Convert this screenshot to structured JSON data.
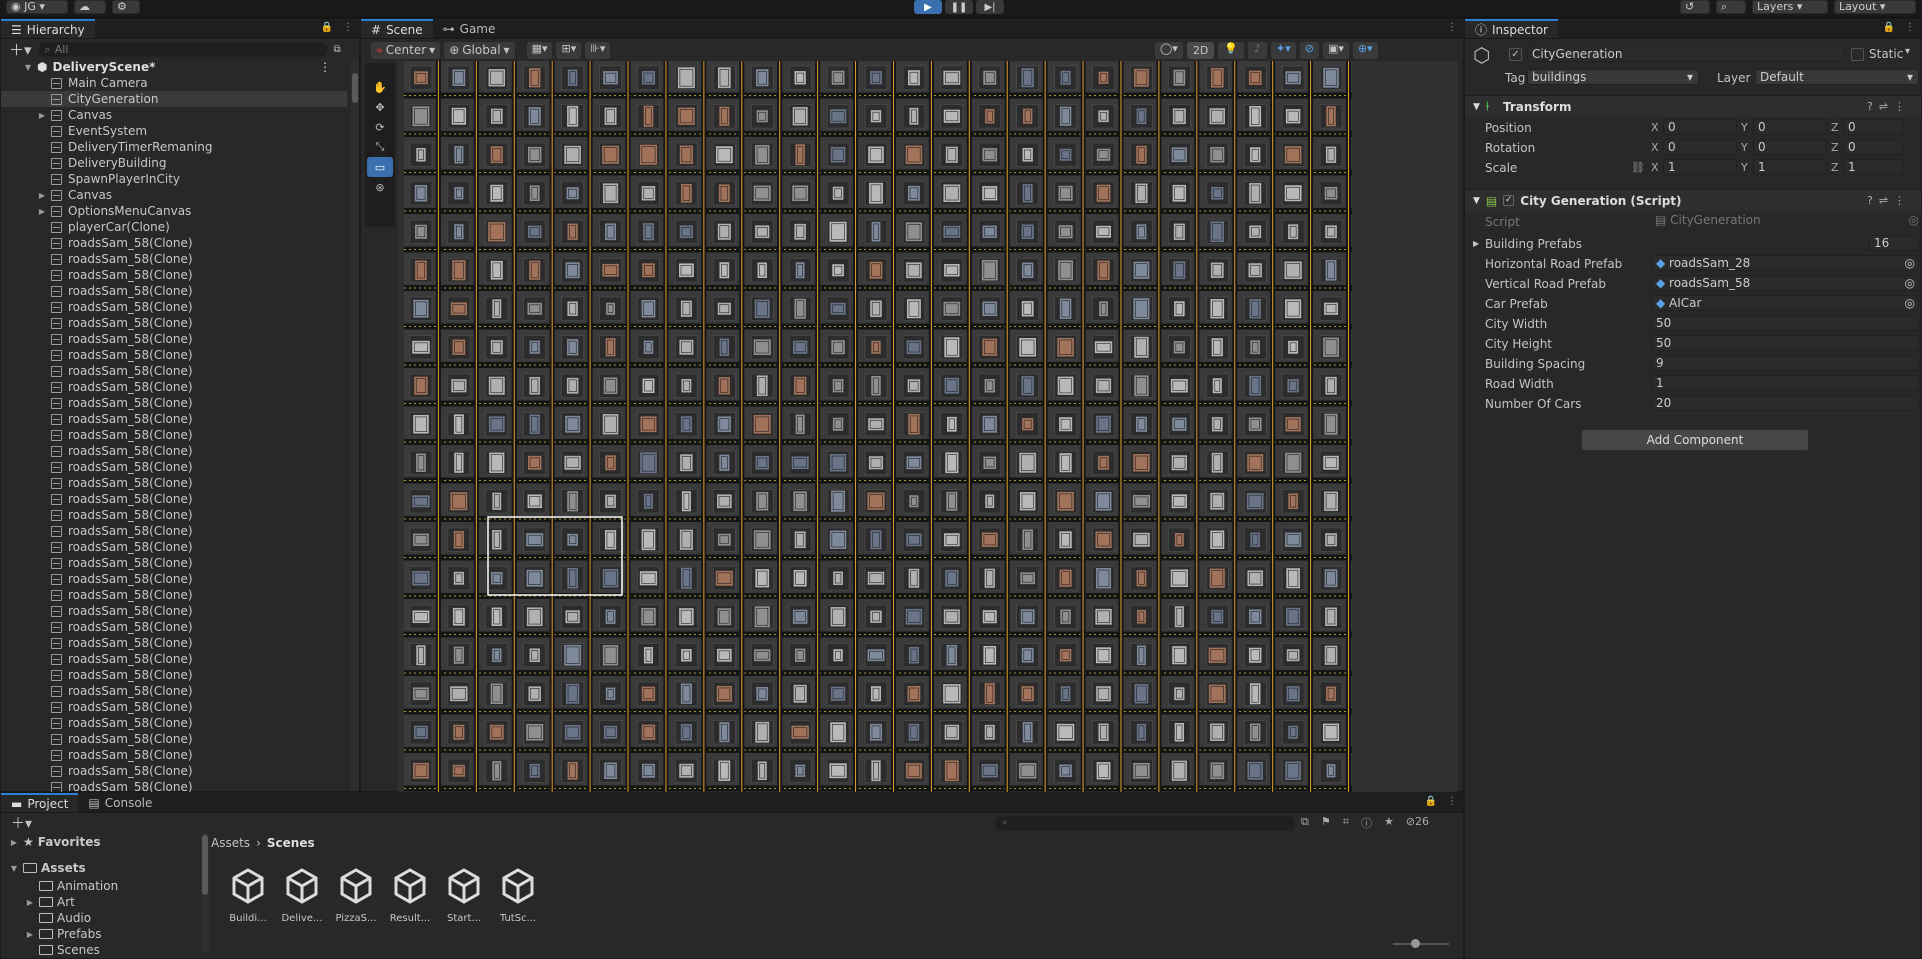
{
  "topbar": {
    "account": "JG",
    "layers": "Layers",
    "layout": "Layout"
  },
  "hierarchy": {
    "tab": "Hierarchy",
    "search_placeholder": "All",
    "scene": "DeliveryScene*",
    "items": [
      {
        "label": "Main Camera",
        "expand": false
      },
      {
        "label": "CityGeneration",
        "expand": false,
        "selected": true
      },
      {
        "label": "Canvas",
        "expand": true
      },
      {
        "label": "EventSystem",
        "expand": false
      },
      {
        "label": "DeliveryTimerRemaning",
        "expand": false
      },
      {
        "label": "DeliveryBuilding",
        "expand": false
      },
      {
        "label": "SpawnPlayerInCity",
        "expand": false
      },
      {
        "label": "Canvas",
        "expand": true
      },
      {
        "label": "OptionsMenuCanvas",
        "expand": true
      },
      {
        "label": "playerCar(Clone)",
        "expand": false
      },
      {
        "label": "roadsSam_58(Clone)",
        "expand": false
      },
      {
        "label": "roadsSam_58(Clone)",
        "expand": false
      },
      {
        "label": "roadsSam_58(Clone)",
        "expand": false
      },
      {
        "label": "roadsSam_58(Clone)",
        "expand": false
      },
      {
        "label": "roadsSam_58(Clone)",
        "expand": false
      },
      {
        "label": "roadsSam_58(Clone)",
        "expand": false
      },
      {
        "label": "roadsSam_58(Clone)",
        "expand": false
      },
      {
        "label": "roadsSam_58(Clone)",
        "expand": false
      },
      {
        "label": "roadsSam_58(Clone)",
        "expand": false
      },
      {
        "label": "roadsSam_58(Clone)",
        "expand": false
      },
      {
        "label": "roadsSam_58(Clone)",
        "expand": false
      },
      {
        "label": "roadsSam_58(Clone)",
        "expand": false
      },
      {
        "label": "roadsSam_58(Clone)",
        "expand": false
      },
      {
        "label": "roadsSam_58(Clone)",
        "expand": false
      },
      {
        "label": "roadsSam_58(Clone)",
        "expand": false
      },
      {
        "label": "roadsSam_58(Clone)",
        "expand": false
      },
      {
        "label": "roadsSam_58(Clone)",
        "expand": false
      },
      {
        "label": "roadsSam_58(Clone)",
        "expand": false
      },
      {
        "label": "roadsSam_58(Clone)",
        "expand": false
      },
      {
        "label": "roadsSam_58(Clone)",
        "expand": false
      },
      {
        "label": "roadsSam_58(Clone)",
        "expand": false
      },
      {
        "label": "roadsSam_58(Clone)",
        "expand": false
      },
      {
        "label": "roadsSam_58(Clone)",
        "expand": false
      },
      {
        "label": "roadsSam_58(Clone)",
        "expand": false
      },
      {
        "label": "roadsSam_58(Clone)",
        "expand": false
      },
      {
        "label": "roadsSam_58(Clone)",
        "expand": false
      },
      {
        "label": "roadsSam_58(Clone)",
        "expand": false
      },
      {
        "label": "roadsSam_58(Clone)",
        "expand": false
      },
      {
        "label": "roadsSam_58(Clone)",
        "expand": false
      },
      {
        "label": "roadsSam_58(Clone)",
        "expand": false
      },
      {
        "label": "roadsSam_58(Clone)",
        "expand": false
      },
      {
        "label": "roadsSam_58(Clone)",
        "expand": false
      },
      {
        "label": "roadsSam_58(Clone)",
        "expand": false
      },
      {
        "label": "roadsSam_58(Clone)",
        "expand": false
      },
      {
        "label": "roadsSam_58(Clone)",
        "expand": false
      }
    ]
  },
  "scene": {
    "tab_scene": "Scene",
    "tab_game": "Game",
    "pivot": "Center",
    "space": "Global",
    "mode_2d": "2D"
  },
  "inspector": {
    "tab": "Inspector",
    "object_name": "CityGeneration",
    "static_label": "Static",
    "tag_label": "Tag",
    "tag_value": "buildings",
    "layer_label": "Layer",
    "layer_value": "Default",
    "transform": {
      "title": "Transform",
      "position_label": "Position",
      "rotation_label": "Rotation",
      "scale_label": "Scale",
      "position": [
        "0",
        "0",
        "0"
      ],
      "rotation": [
        "0",
        "0",
        "0"
      ],
      "scale": [
        "1",
        "1",
        "1"
      ]
    },
    "script": {
      "title": "City Generation (Script)",
      "script_label": "Script",
      "script_value": "CityGeneration",
      "fields": [
        {
          "label": "Building Prefabs",
          "value": "16"
        },
        {
          "label": "Horizontal Road Prefab",
          "value": "roadsSam_28"
        },
        {
          "label": "Vertical Road Prefab",
          "value": "roadsSam_58"
        },
        {
          "label": "Car Prefab",
          "value": "AICar"
        },
        {
          "label": "City Width",
          "value": "50"
        },
        {
          "label": "City Height",
          "value": "50"
        },
        {
          "label": "Building Spacing",
          "value": "9"
        },
        {
          "label": "Road Width",
          "value": "1"
        },
        {
          "label": "Number Of Cars",
          "value": "20"
        }
      ]
    },
    "add_component": "Add Component"
  },
  "project": {
    "tab_project": "Project",
    "tab_console": "Console",
    "hidden_count": "26",
    "favorites": "Favorites",
    "assets": "Assets",
    "folders": [
      "Animation",
      "Art",
      "Audio",
      "Prefabs",
      "Scenes"
    ],
    "breadcrumb": [
      "Assets",
      "Scenes"
    ],
    "files": [
      "Buildi...",
      "Delive...",
      "PizzaS...",
      "Result...",
      "Start...",
      "TutSc..."
    ]
  },
  "colors": {
    "accent": "#2d7fd6",
    "road": "#e0a030",
    "panel": "#282828"
  }
}
